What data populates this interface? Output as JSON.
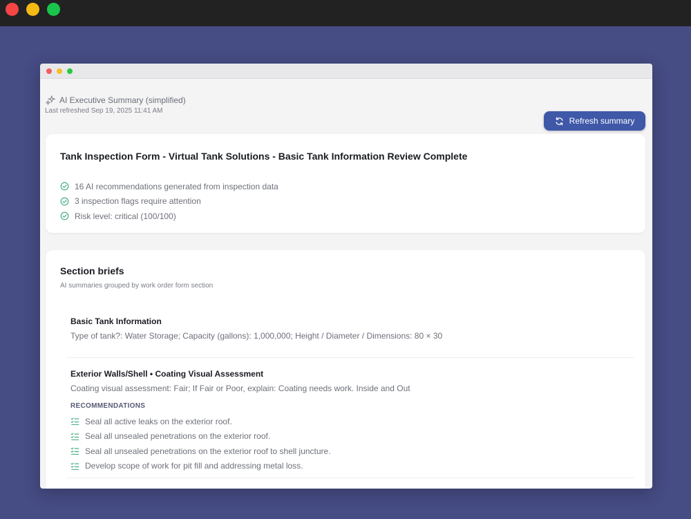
{
  "window": {
    "header": {
      "title": "AI Executive Summary (simplified)",
      "last_refreshed": "Last refreshed Sep 19, 2025 11:41 AM",
      "refresh_button": "Refresh summary"
    },
    "summary": {
      "title": "Tank Inspection Form - Virtual Tank Solutions - Basic Tank Information Review Complete",
      "items": [
        "16 AI recommendations generated from inspection data",
        "3 inspection flags require attention",
        "Risk level: critical (100/100)"
      ]
    },
    "sections": {
      "title": "Section briefs",
      "subtitle": "AI summaries grouped by work order form section",
      "briefs": [
        {
          "title": "Basic Tank Information",
          "text": "Type of tank?: Water Storage; Capacity (gallons): 1,000,000; Height / Diameter / Dimensions: 80 × 30"
        },
        {
          "title": "Exterior Walls/Shell • Coating Visual Assessment",
          "text": "Coating visual assessment: Fair; If Fair or Poor, explain: Coating needs work. Inside and Out",
          "recommendations_label": "RECOMMENDATIONS",
          "recommendations": [
            "Seal all active leaks on the exterior roof.",
            "Seal all unsealed penetrations on the exterior roof.",
            "Seal all unsealed penetrations on the exterior roof to shell juncture.",
            "Develop scope of work for pit fill and addressing metal loss."
          ]
        }
      ]
    }
  },
  "colors": {
    "background": "#464c84",
    "accent": "#3f58a8",
    "check": "#3aa87a"
  }
}
